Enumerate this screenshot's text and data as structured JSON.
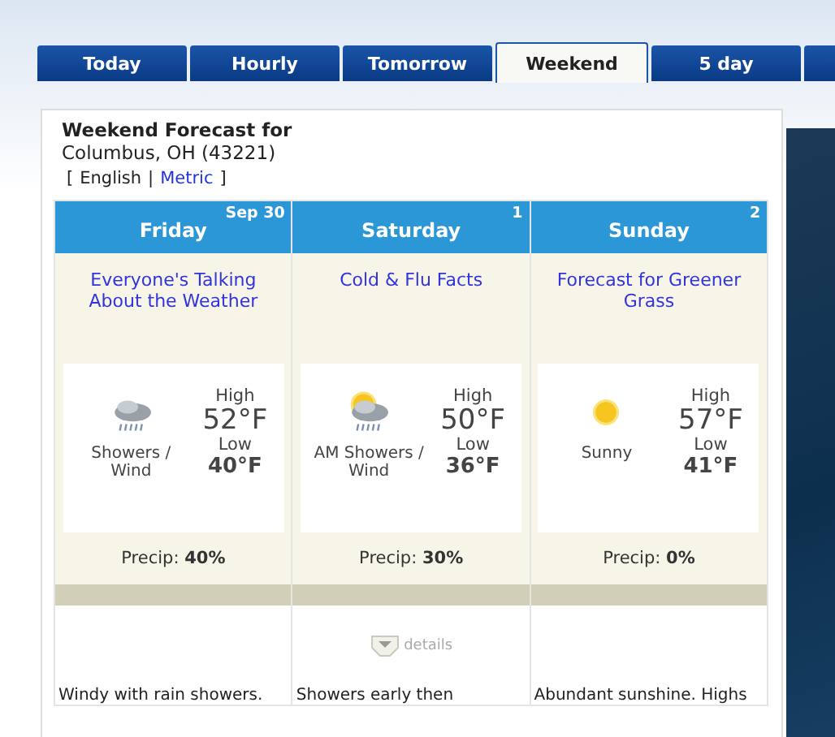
{
  "tabs": [
    {
      "label": "Today",
      "selected": false
    },
    {
      "label": "Hourly",
      "selected": false
    },
    {
      "label": "Tomorrow",
      "selected": false
    },
    {
      "label": "Weekend",
      "selected": true
    },
    {
      "label": "5 day",
      "selected": false
    }
  ],
  "heading": {
    "title": "Weekend Forecast for",
    "location": "Columbus, OH (43221)"
  },
  "units": {
    "open": "[",
    "english": "English",
    "separator": "|",
    "metric": "Metric",
    "close": "]"
  },
  "days": [
    {
      "day": "Friday",
      "date": "Sep 30",
      "article": "Everyone's Talking About the Weather",
      "kind": "rain",
      "condition": "Showers / Wind",
      "high_label": "High",
      "high": "52°F",
      "low_label": "Low",
      "low": "40°F",
      "precip": "Precip: **40%**",
      "summary": "Windy with rain showers."
    },
    {
      "day": "Saturday",
      "date": "1",
      "article": "Cold & Flu Facts",
      "kind": "sun-rain",
      "condition": "AM Showers / Wind",
      "high_label": "High",
      "high": "50°F",
      "low_label": "Low",
      "low": "36°F",
      "precip": "Precip: **30%**",
      "details": "details",
      "summary": "Showers early then"
    },
    {
      "day": "Sunday",
      "date": "2",
      "article": "Forecast for Greener Grass",
      "kind": "sun",
      "condition": "Sunny",
      "high_label": "High",
      "high": "57°F",
      "low_label": "Low",
      "low": "41°F",
      "precip": "Precip: **0%**",
      "summary": "Abundant sunshine. Highs"
    }
  ]
}
